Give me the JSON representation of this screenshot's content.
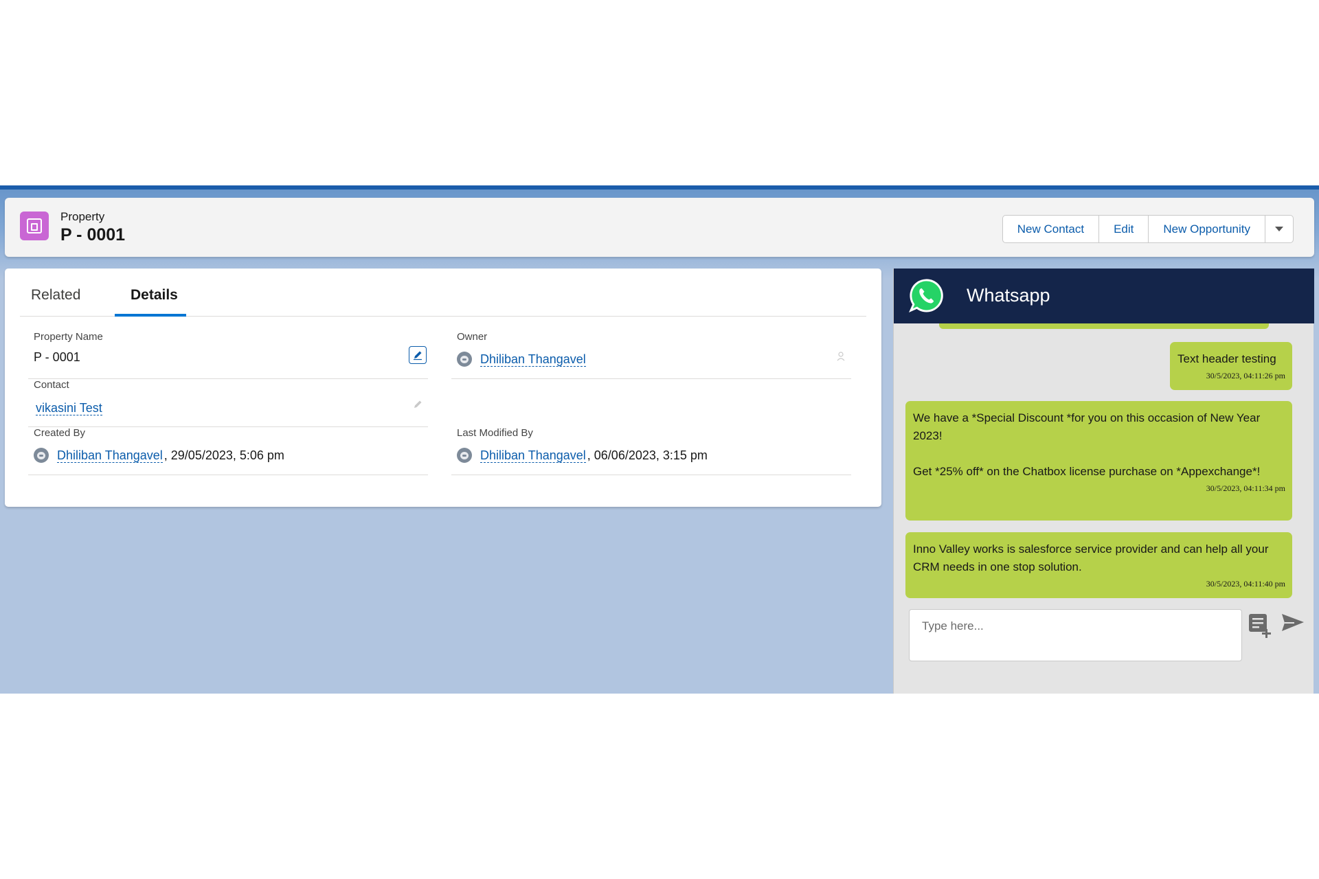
{
  "header": {
    "object_label": "Property",
    "record_name": "P - 0001",
    "buttons": [
      "New Contact",
      "Edit",
      "New Opportunity"
    ],
    "menu_icon": "chevron-down-icon",
    "object_icon": "property-icon",
    "object_icon_color": "#c966d4"
  },
  "tabs": {
    "related": "Related",
    "details": "Details",
    "active": "Details"
  },
  "fields": {
    "property_name": {
      "label": "Property Name",
      "value": "P - 0001"
    },
    "owner": {
      "label": "Owner",
      "value": "Dhiliban Thangavel"
    },
    "contact": {
      "label": "Contact",
      "value": "vikasini Test"
    },
    "created_by": {
      "label": "Created By",
      "user": "Dhiliban Thangavel",
      "date": ", 29/05/2023, 5:06 pm"
    },
    "last_modified_by": {
      "label": "Last Modified By",
      "user": "Dhiliban Thangavel",
      "date": ", 06/06/2023, 3:15 pm"
    }
  },
  "whatsapp": {
    "title": "Whatsapp",
    "header_color": "#14254a",
    "bubble_color": "#b6d14a",
    "messages": [
      {
        "text": "Text header testing",
        "time": "30/5/2023, 04:11:26 pm"
      },
      {
        "text": "We have a *Special Discount *for you on this occasion of New Year 2023!\n\nGet *25% off* on the Chatbox license purchase on *Appexchange*!",
        "time": "30/5/2023, 04:11:34 pm"
      },
      {
        "text": "Inno Valley works is salesforce service provider and can help all your CRM needs in one stop solution.",
        "time": "30/5/2023, 04:11:40 pm"
      }
    ],
    "input_placeholder": "Type here...",
    "template_icon": "add-template-icon",
    "send_icon": "send-icon"
  },
  "colors": {
    "link": "#0b5cab",
    "tab_accent": "#0176d3",
    "frame_blue": "#1b5dab",
    "background": "#b1c5e0"
  }
}
